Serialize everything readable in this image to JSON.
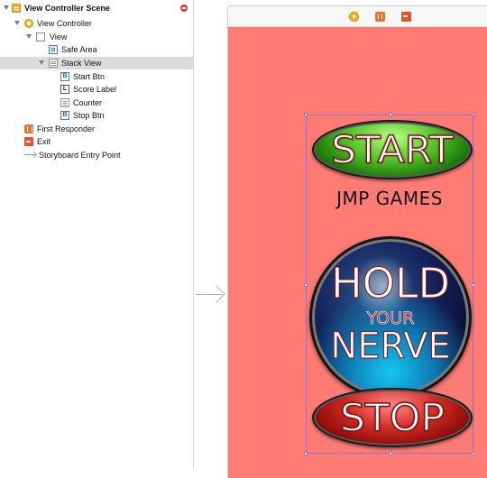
{
  "outline": {
    "scene_title": "View Controller Scene",
    "items": [
      {
        "label": "View Controller"
      },
      {
        "label": "View"
      },
      {
        "label": "Safe Area"
      },
      {
        "label": "Stack View"
      },
      {
        "label": "Start Btn",
        "icon_letter": "B"
      },
      {
        "label": "Score Label",
        "icon_letter": "L"
      },
      {
        "label": "Counter"
      },
      {
        "label": "Stop Btn",
        "icon_letter": "B"
      },
      {
        "label": "First Responder"
      },
      {
        "label": "Exit"
      },
      {
        "label": "Storyboard Entry Point"
      }
    ],
    "selected_item": "Stack View"
  },
  "canvas": {
    "background_color": "#ff7b74",
    "start_button": "START",
    "score_label": "JMP GAMES",
    "counter": {
      "line1": "HOLD",
      "line2": "YOUR",
      "line3": "NERVE"
    },
    "stop_button": "STOP",
    "selection_color": "#8f70cf"
  }
}
